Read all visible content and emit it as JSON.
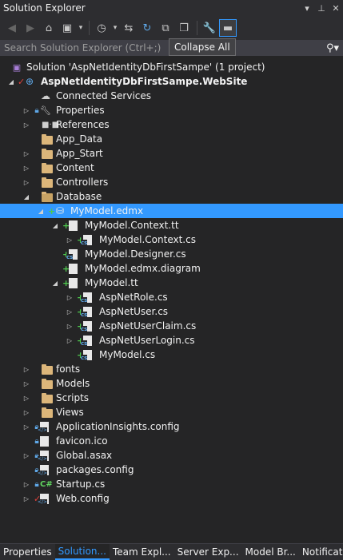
{
  "window": {
    "title": "Solution Explorer"
  },
  "tooltip": {
    "text": "Collapse All"
  },
  "search": {
    "placeholder": "Search Solution Explorer (Ctrl+;)"
  },
  "tree": {
    "solution": "Solution 'AspNetIdentityDbFirstSampe' (1 project)",
    "project": "AspNetIdentityDbFirstSampe.WebSite",
    "connected_services": "Connected Services",
    "properties": "Properties",
    "references": "References",
    "app_data": "App_Data",
    "app_start": "App_Start",
    "content": "Content",
    "controllers": "Controllers",
    "database": "Database",
    "mymodel_edmx": "MyModel.edmx",
    "context_tt": "MyModel.Context.tt",
    "context_cs": "MyModel.Context.cs",
    "designer_cs": "MyModel.Designer.cs",
    "edmx_diagram": "MyModel.edmx.diagram",
    "mymodel_tt": "MyModel.tt",
    "role_cs": "AspNetRole.cs",
    "user_cs": "AspNetUser.cs",
    "claim_cs": "AspNetUserClaim.cs",
    "login_cs": "AspNetUserLogin.cs",
    "mymodel_cs": "MyModel.cs",
    "fonts": "fonts",
    "models": "Models",
    "scripts": "Scripts",
    "views": "Views",
    "appinsights": "ApplicationInsights.config",
    "favicon": "favicon.ico",
    "global": "Global.asax",
    "packages": "packages.config",
    "startup": "Startup.cs",
    "webconfig": "Web.config"
  },
  "tabs": [
    "Properties",
    "Solution...",
    "Team Expl...",
    "Server Exp...",
    "Model Br...",
    "Notificati..."
  ]
}
